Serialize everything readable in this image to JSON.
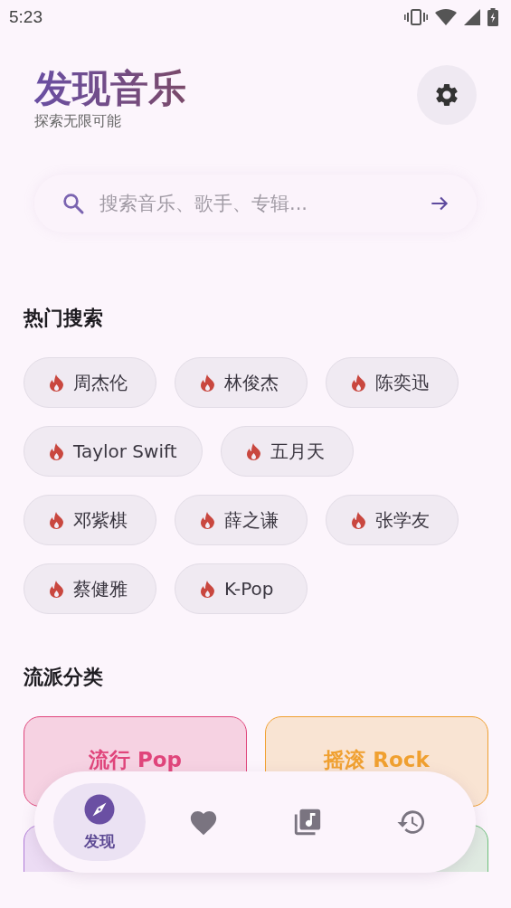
{
  "status_bar": {
    "time": "5:23"
  },
  "header": {
    "title": "发现音乐",
    "subtitle": "探索无限可能"
  },
  "search": {
    "placeholder": "搜索音乐、歌手、专辑..."
  },
  "hot_search": {
    "title": "热门搜索",
    "chips": [
      {
        "label": "周杰伦"
      },
      {
        "label": "林俊杰"
      },
      {
        "label": "陈奕迅"
      },
      {
        "label": "Taylor Swift"
      },
      {
        "label": "五月天"
      },
      {
        "label": "邓紫棋"
      },
      {
        "label": "薛之谦"
      },
      {
        "label": "张学友"
      },
      {
        "label": "蔡健雅"
      },
      {
        "label": "K-Pop"
      }
    ]
  },
  "genres": {
    "title": "流派分类",
    "cards": [
      {
        "label": "流行 Pop",
        "color": "#e0457b"
      },
      {
        "label": "摇滚 Rock",
        "color": "#f0a030"
      },
      {
        "color": "#b07ad8"
      },
      {
        "color": "#6cbf7a"
      }
    ]
  },
  "bottom_nav": {
    "items": [
      {
        "kind": "discover",
        "label": "发现",
        "selected": true
      },
      {
        "kind": "favorites",
        "selected": false
      },
      {
        "kind": "library",
        "selected": false
      },
      {
        "kind": "history",
        "selected": false
      }
    ]
  }
}
